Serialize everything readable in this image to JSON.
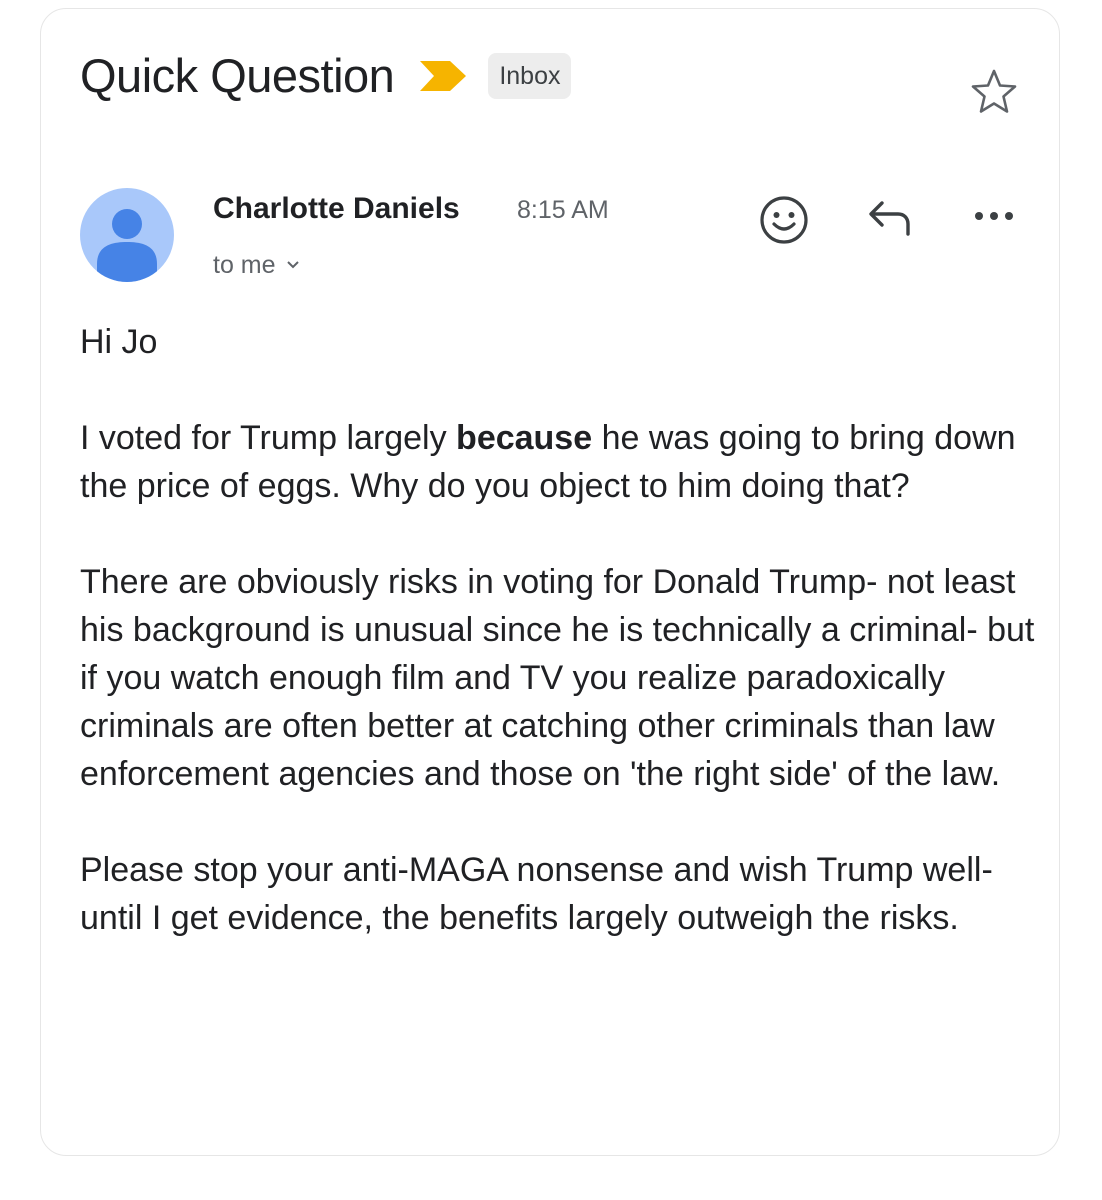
{
  "email": {
    "subject": "Quick Question",
    "label": "Inbox",
    "importance_color": "#f6b400",
    "icons": {
      "importance": "importance-marker-icon",
      "star": "star-outline-icon",
      "avatar": "person-icon",
      "emoji": "smiley-face-icon",
      "reply": "reply-arrow-icon",
      "more": "more-dots-icon",
      "recipient_toggle": "chevron-down-icon"
    },
    "sender": {
      "name": "Charlotte Daniels",
      "time": "8:15 AM",
      "recipient": "to me",
      "avatar_color": "#a9c8fa",
      "avatar_figure_color": "#4683e6"
    },
    "body": {
      "greeting": "Hi Jo",
      "p1_before": "I voted for Trump largely ",
      "p1_bold": "because",
      "p1_after": " he was going to bring down the price of eggs. Why do you object to him doing that?",
      "p2": "There are obviously risks in voting for Donald Trump- not least his background is unusual since he is technically a criminal- but if you watch enough film and TV you realize paradoxically criminals are often better at catching other criminals than law enforcement agencies and those on 'the right side' of the law.",
      "p3": "Please stop your anti-MAGA nonsense and wish Trump well- until I get evidence, the benefits largely outweigh the risks."
    }
  }
}
